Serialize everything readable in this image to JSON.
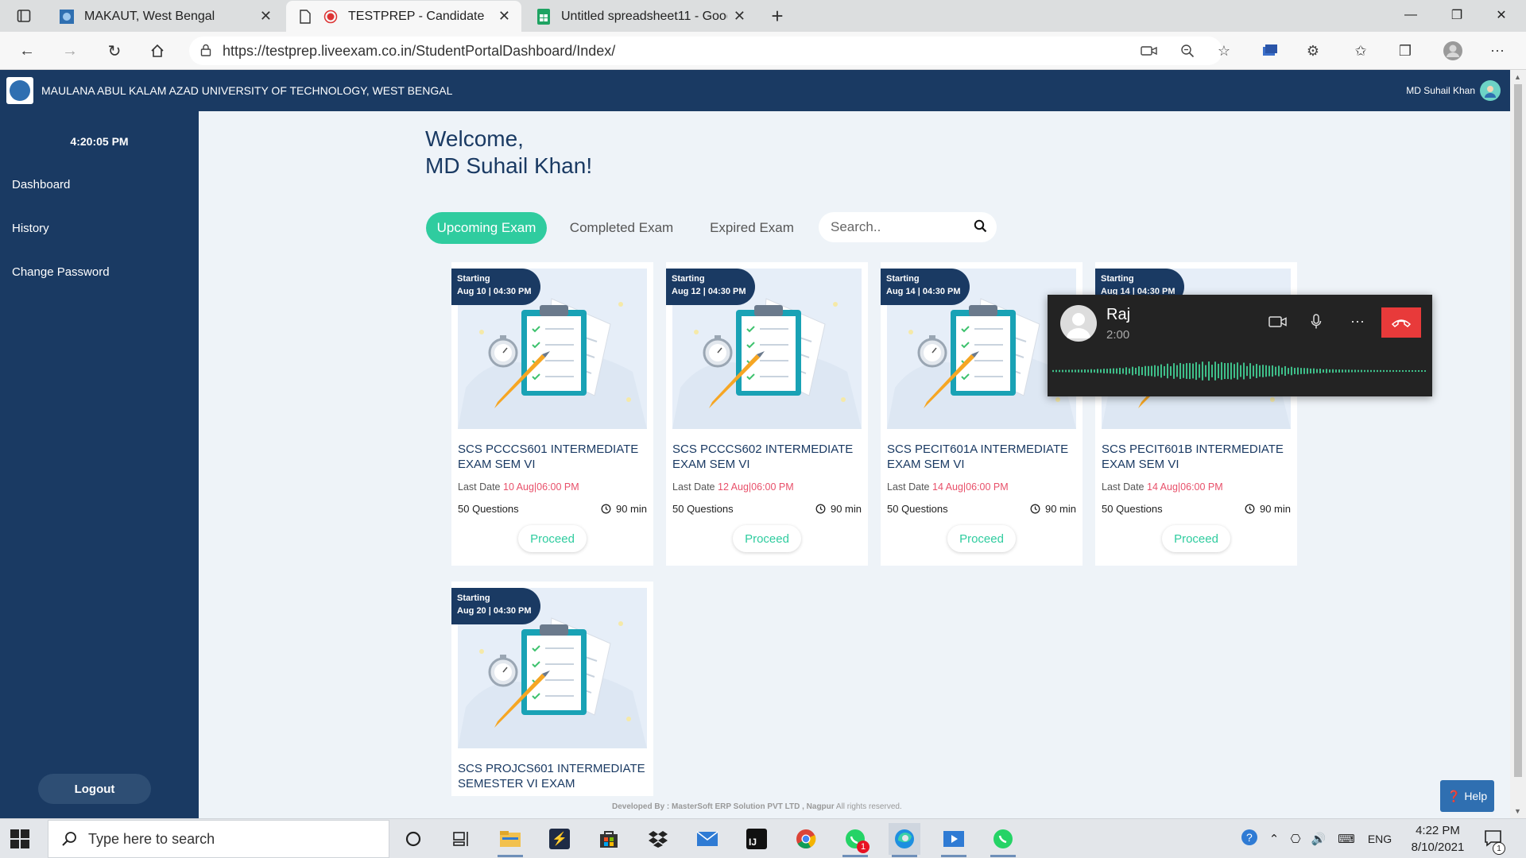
{
  "browser": {
    "tabs": [
      {
        "title": "MAKAUT, West Bengal",
        "active": false
      },
      {
        "title": "TESTPREP - Candidate",
        "active": true
      },
      {
        "title": "Untitled spreadsheet11 - Google",
        "active": false
      }
    ],
    "url": "https://testprep.liveexam.co.in/StudentPortalDashboard/Index/"
  },
  "header": {
    "university": "MAULANA ABUL KALAM AZAD UNIVERSITY OF TECHNOLOGY, WEST BENGAL",
    "user": "MD Suhail Khan"
  },
  "sidebar": {
    "time": "4:20:05 PM",
    "items": [
      {
        "label": "Dashboard"
      },
      {
        "label": "History"
      },
      {
        "label": "Change Password"
      }
    ],
    "logout": "Logout"
  },
  "main": {
    "welcome_line1": "Welcome,",
    "welcome_line2": "MD Suhail Khan!",
    "tabs": [
      {
        "label": "Upcoming Exam",
        "active": true
      },
      {
        "label": "Completed Exam",
        "active": false
      },
      {
        "label": "Expired Exam",
        "active": false
      }
    ],
    "search_placeholder": "Search..",
    "exams": [
      {
        "starting": "Starting",
        "date": "Aug 10 | 04:30 PM",
        "title": "SCS PCCCS601 INTERMEDIATE EXAM SEM VI",
        "last_date_label": "Last Date",
        "last_date": "10 Aug|06:00 PM",
        "questions": "50 Questions",
        "duration": "90 min",
        "action": "Proceed"
      },
      {
        "starting": "Starting",
        "date": "Aug 12 | 04:30 PM",
        "title": "SCS PCCCS602 INTERMEDIATE EXAM SEM VI",
        "last_date_label": "Last Date",
        "last_date": "12 Aug|06:00 PM",
        "questions": "50 Questions",
        "duration": "90 min",
        "action": "Proceed"
      },
      {
        "starting": "Starting",
        "date": "Aug 14 | 04:30 PM",
        "title": "SCS PECIT601A INTERMEDIATE EXAM SEM VI",
        "last_date_label": "Last Date",
        "last_date": "14 Aug|06:00 PM",
        "questions": "50 Questions",
        "duration": "90 min",
        "action": "Proceed"
      },
      {
        "starting": "Starting",
        "date": "Aug 14 | 04:30 PM",
        "title": "SCS PECIT601B INTERMEDIATE EXAM SEM VI",
        "last_date_label": "Last Date",
        "last_date": "14 Aug|06:00 PM",
        "questions": "50 Questions",
        "duration": "90 min",
        "action": "Proceed"
      },
      {
        "starting": "Starting",
        "date": "Aug 20 | 04:30 PM",
        "title": "SCS PROJCS601 INTERMEDIATE SEMESTER VI EXAM",
        "last_date_label": "",
        "last_date": "",
        "questions": "",
        "duration": "",
        "action": ""
      }
    ],
    "footer_prefix": "Developed By :",
    "footer_company": "MasterSoft ERP Solution PVT LTD , Nagpur",
    "footer_rights": "All rights reserved.",
    "help": "Help"
  },
  "call": {
    "name": "Raj",
    "time": "2:00"
  },
  "taskbar": {
    "search_placeholder": "Type here to search",
    "whatsapp_badge": "1",
    "language": "ENG",
    "time": "4:22 PM",
    "date": "8/10/2021",
    "notification_count": "1"
  },
  "colors": {
    "navy": "#1a3a63",
    "accent": "#2fcc9f",
    "red_text": "#e8506a",
    "main_bg": "#eef3f8"
  }
}
